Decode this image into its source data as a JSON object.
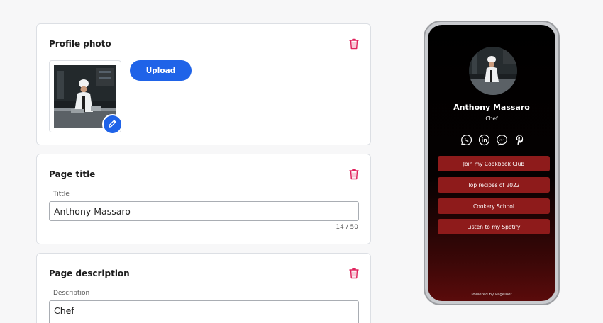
{
  "editor": {
    "photo_card": {
      "title": "Profile photo",
      "upload_label": "Upload"
    },
    "title_card": {
      "title": "Page title",
      "field_label": "Tittle",
      "value": "Anthony Massaro",
      "counter": "14 / 50"
    },
    "description_card": {
      "title": "Page description",
      "field_label": "Description",
      "value": "Chef"
    }
  },
  "preview": {
    "name": "Anthony Massaro",
    "subtitle": "Chef",
    "social_icons": [
      "whatsapp-icon",
      "linkedin-icon",
      "messenger-icon",
      "pinterest-icon"
    ],
    "links": [
      {
        "label": "Join my Cookbook Club"
      },
      {
        "label": "Top recipes of 2022"
      },
      {
        "label": "Cookery School"
      },
      {
        "label": "Listen to my Spotify"
      }
    ],
    "footer": "Powered by Pageloot"
  },
  "colors": {
    "accent": "#1f63e8",
    "delete": "#e0245e",
    "link_button": "#8e1b1b"
  }
}
